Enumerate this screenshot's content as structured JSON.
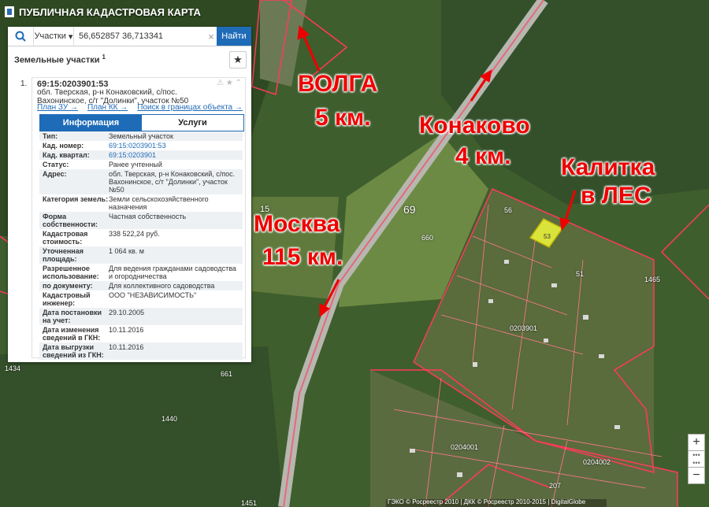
{
  "app": {
    "title": "ПУБЛИЧНАЯ КАДАСТРОВАЯ КАРТА"
  },
  "search": {
    "type_label": "Участки",
    "value": "56,652857 36,713341",
    "button": "Найти"
  },
  "panel": {
    "title": "Земельные участки",
    "count": "1",
    "item": {
      "index": "1.",
      "cad_number": "69:15:0203901:53",
      "address_line1": "обл. Тверская, р-н Конаковский, с/пос.",
      "address_line2": "Вахонинское, с/т \"Долинки\", участок №50",
      "links": [
        "План ЗУ →",
        "План КК →",
        "Поиск в границах объекта →"
      ]
    },
    "tabs": [
      "Информация",
      "Услуги"
    ],
    "rows": [
      {
        "label": "Тип:",
        "value": "Земельный участок"
      },
      {
        "label": "Кад. номер:",
        "value": "69:15:0203901:53"
      },
      {
        "label": "Кад. квартал:",
        "value": "69:15:0203901"
      },
      {
        "label": "Статус:",
        "value": "Ранее учтенный"
      },
      {
        "label": "Адрес:",
        "value": "обл. Тверская, р-н Конаковский, с/пос. Вахонинское, с/т \"Долинки\", участок №50"
      },
      {
        "label": "Категория земель:",
        "value": "Земли сельскохозяйственного назначения"
      },
      {
        "label": "Форма собственности:",
        "value": "Частная собственность"
      },
      {
        "label": "Кадастровая стоимость:",
        "value": "338 522,24 руб."
      },
      {
        "label": "Уточненная площадь:",
        "value": "1 064 кв. м"
      },
      {
        "label": "Разрешенное использование:",
        "value": "Для ведения гражданами садоводства и огородничества"
      },
      {
        "label": "по документу:",
        "value": "Для коллективного садоводства"
      },
      {
        "label": "Кадастровый инженер:",
        "value": "ООО \"НЕЗАВИСИМОСТЬ\""
      },
      {
        "label": "Дата постановки на учет:",
        "value": "29.10.2005"
      },
      {
        "label": "Дата изменения сведений в ГКН:",
        "value": "10.11.2016"
      },
      {
        "label": "Дата выгрузки сведений из ГКН:",
        "value": "10.11.2016"
      }
    ]
  },
  "annotations": {
    "volga1": "ВОЛГА",
    "volga2": "5 км.",
    "konakovo1": "Конаково",
    "konakovo2": "4 км.",
    "kalitka1": "Калитка",
    "kalitka2": "в ЛЕС",
    "moskva1": "Москва",
    "moskva2": "115 км."
  },
  "map_labels": {
    "road": "69",
    "n15": "15",
    "n660": "660",
    "n1465": "1465",
    "block1": "0203901",
    "block2": "0204001",
    "block3": "0204002",
    "n1434": "1434",
    "n1440": "1440",
    "n661": "661",
    "n53": "53",
    "n56": "56",
    "n51": "51",
    "n1451": "1451",
    "n207": "207"
  },
  "attribution": "ГЭКО © Росреестр 2010 | ДКК © Росреестр 2010-2015 | DigitalGlobe",
  "zoom": {
    "plus": "+",
    "minus": "−"
  }
}
